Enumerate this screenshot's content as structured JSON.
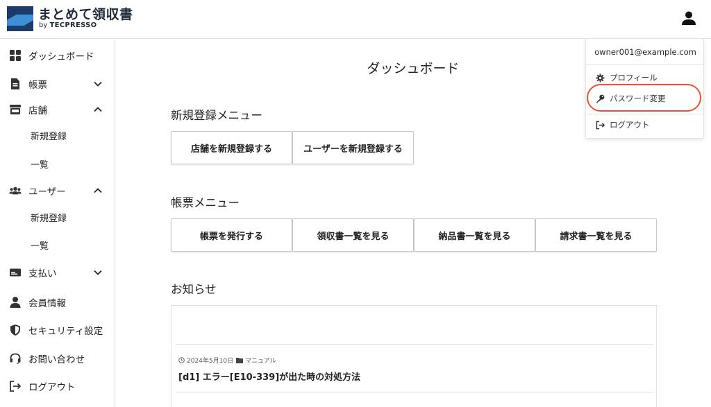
{
  "app": {
    "title": "まとめて領収書",
    "byline_prefix": "by",
    "byline_brand": "TECPRESSO"
  },
  "colors": {
    "logo_dark": "#1c3b6b",
    "logo_light": "#3d8fd8",
    "highlight": "#e8522e"
  },
  "sidebar": {
    "items": [
      {
        "label": "ダッシュボード",
        "icon": "dashboard-grid-icon"
      },
      {
        "label": "帳票",
        "icon": "document-icon",
        "chevron": "down"
      },
      {
        "label": "店舗",
        "icon": "store-icon",
        "chevron": "up"
      },
      {
        "label": "新規登録",
        "sub": true
      },
      {
        "label": "一覧",
        "sub": true
      },
      {
        "label": "ユーザー",
        "icon": "users-icon",
        "chevron": "up"
      },
      {
        "label": "新規登録",
        "sub": true
      },
      {
        "label": "一覧",
        "sub": true
      },
      {
        "label": "支払い",
        "icon": "card-icon",
        "chevron": "down"
      },
      {
        "label": "会員情報",
        "icon": "person-icon"
      },
      {
        "label": "セキュリティ設定",
        "icon": "shield-icon"
      },
      {
        "label": "お問い合わせ",
        "icon": "headset-icon"
      },
      {
        "label": "ログアウト",
        "icon": "logout-icon"
      }
    ]
  },
  "main": {
    "title": "ダッシュボード",
    "register_menu": {
      "title": "新規登録メニュー",
      "buttons": [
        "店舗を新規登録する",
        "ユーザーを新規登録する"
      ]
    },
    "report_menu": {
      "title": "帳票メニュー",
      "buttons": [
        "帳票を発行する",
        "領収書一覧を見る",
        "納品書一覧を見る",
        "請求書一覧を見る"
      ]
    },
    "news": {
      "title": "お知らせ",
      "items": [
        {
          "date": "2024年5月10日",
          "category": "マニュアル",
          "title": "[d1] エラー[E10-339]が出た時の対処方法"
        }
      ]
    }
  },
  "user_menu": {
    "email": "owner001@example.com",
    "items": [
      {
        "label": "プロフィール",
        "icon": "gear-icon"
      },
      {
        "label": "パスワード変更",
        "icon": "key-icon"
      },
      {
        "label": "ログアウト",
        "icon": "logout-icon"
      }
    ]
  }
}
